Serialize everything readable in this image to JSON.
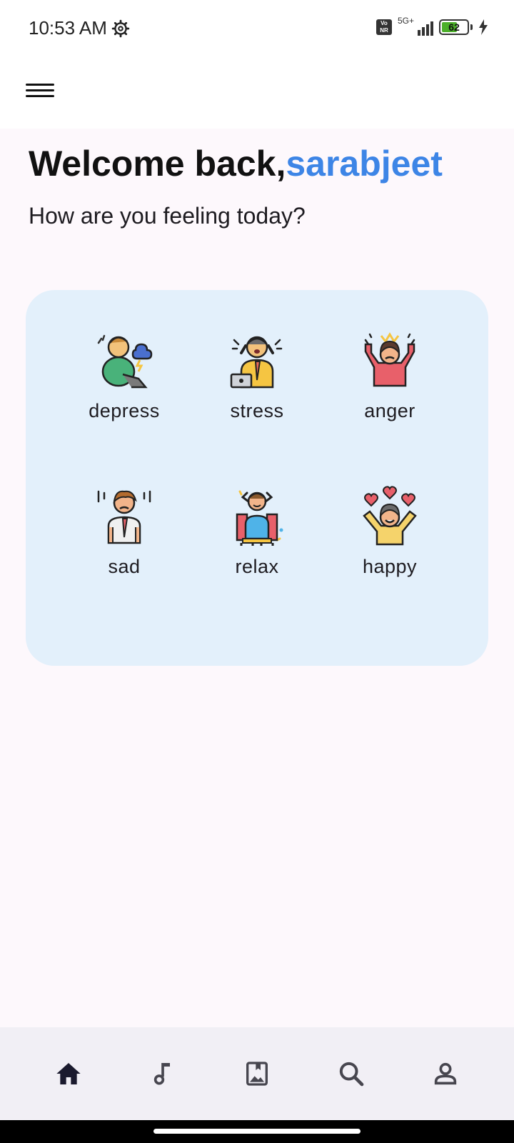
{
  "status_bar": {
    "time": "10:53 AM",
    "settings_icon": "gear-icon",
    "volte": "Vo NR",
    "network": "5G+",
    "battery_level": "62",
    "battery_fraction": 0.62,
    "charging_icon": "bolt-icon"
  },
  "app_bar": {
    "menu_icon": "menu-icon"
  },
  "greeting": {
    "prefix": "Welcome back,",
    "username": "sarabjeet",
    "question": "How are you feeling today?"
  },
  "moods": [
    {
      "label": "depress",
      "icon": "depress-icon"
    },
    {
      "label": "stress",
      "icon": "stress-icon"
    },
    {
      "label": "anger",
      "icon": "anger-icon"
    },
    {
      "label": "sad",
      "icon": "sad-icon"
    },
    {
      "label": "relax",
      "icon": "relax-icon"
    },
    {
      "label": "happy",
      "icon": "happy-icon"
    }
  ],
  "bottom_nav": [
    {
      "icon": "home-icon",
      "active": true
    },
    {
      "icon": "music-note-icon",
      "active": false
    },
    {
      "icon": "image-bookmark-icon",
      "active": false
    },
    {
      "icon": "search-icon",
      "active": false
    },
    {
      "icon": "profile-icon",
      "active": false
    }
  ],
  "colors": {
    "accent": "#3d85e6",
    "card": "#e3f0fb",
    "nav_bg": "#f1eff5",
    "page_bg": "#fdf8fc"
  }
}
